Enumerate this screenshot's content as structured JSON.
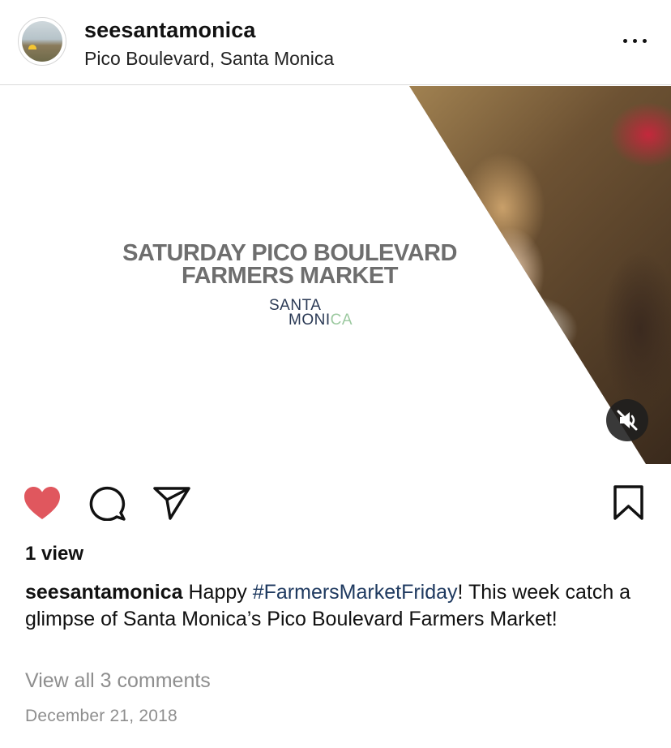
{
  "post": {
    "username": "seesantamonica",
    "location": "Pico Boulevard, Santa Monica",
    "avatar_icon": "profile-avatar-icon",
    "more_icon": "more-options-icon"
  },
  "media": {
    "title_line1": "SATURDAY PICO BOULEVARD",
    "title_line2": "FARMERS MARKET",
    "logo_line1": "SANTA",
    "logo_line2a": "MONI",
    "logo_line2b": "CA",
    "mute_icon": "speaker-muted-icon"
  },
  "actions": {
    "like_icon": "heart-filled-icon",
    "like_color": "#ed4956",
    "comment_icon": "comment-bubble-icon",
    "share_icon": "paper-plane-icon",
    "save_icon": "bookmark-icon"
  },
  "stats": {
    "views": "1 view"
  },
  "caption": {
    "username": "seesantamonica",
    "text_before": " Happy ",
    "hashtag": "#FarmersMarketFriday",
    "text_after": "! This week catch a glimpse of Santa Monica’s Pico Boulevard Farmers Market!"
  },
  "comments_link": "View all 3 comments",
  "date": "December 21, 2018"
}
